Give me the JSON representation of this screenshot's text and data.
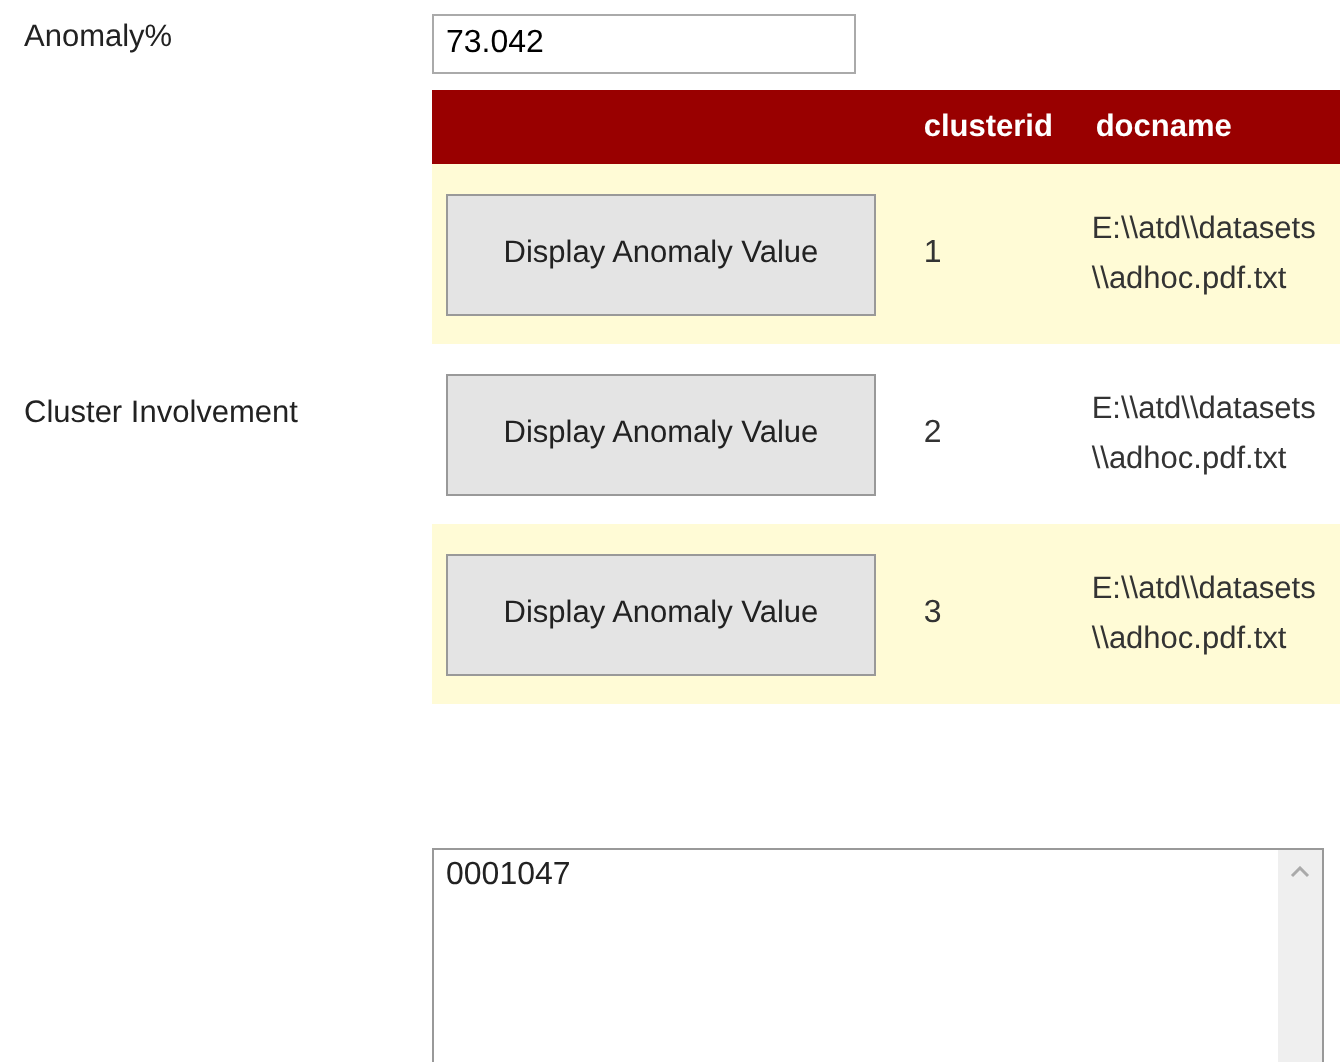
{
  "fields": [
    {
      "label": "Anomaly%",
      "value": "73.042"
    },
    {
      "label": "Cluster Involvement"
    }
  ],
  "table": {
    "columns": [
      "",
      "clusterid",
      "docname"
    ],
    "rows": [
      {
        "button": "Display Anomaly Value",
        "clusterid": "1",
        "docname": "E:\\\\atd\\\\datasets\\\\adhoc.pdf.txt"
      },
      {
        "button": "Display Anomaly Value",
        "clusterid": "2",
        "docname": "E:\\\\atd\\\\datasets\\\\adhoc.pdf.txt"
      },
      {
        "button": "Display Anomaly Value",
        "clusterid": "3",
        "docname": "E:\\\\atd\\\\datasets\\\\adhoc.pdf.txt"
      }
    ]
  },
  "output": {
    "value": "0001047"
  }
}
